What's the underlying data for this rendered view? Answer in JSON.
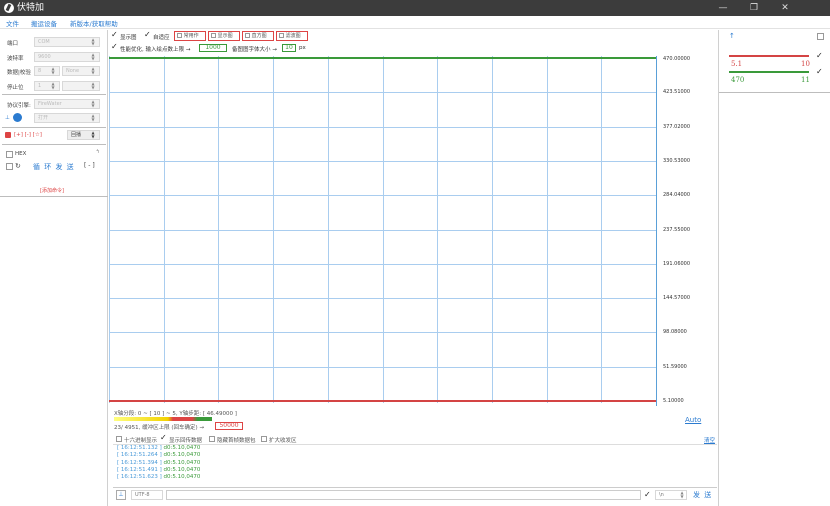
{
  "window": {
    "title": "伏特加",
    "minimize": "—",
    "maximize": "❐",
    "close": "✕"
  },
  "menu": [
    "文件",
    "搬运设备",
    "新版本/获取帮助"
  ],
  "left_panel": {
    "fields": [
      {
        "label": "端口",
        "value": "COM"
      },
      {
        "label": "波特率",
        "value": "9600"
      },
      {
        "label": "数据|校验",
        "value": "8",
        "value2": "None"
      },
      {
        "label": "停止位",
        "value": "1"
      }
    ],
    "protocol_label": "协议引擎:",
    "protocol_value": "FireWater",
    "connect_hint": "打开",
    "cmd_icons": "[+] [-] [☆]",
    "cmd_button": "回播",
    "hex_label": "HEX",
    "loop_send": "循 环 发 送",
    "loop_bracket": "[ - ]",
    "add_command": "[添加命令]"
  },
  "toolbar": {
    "show_graph": "显示图",
    "follow": "自适应",
    "tabs": [
      "常用作",
      "显示图",
      "直方图",
      "滤波图"
    ],
    "perf_label": "性能优化, 输入绘点数上限 →",
    "perf_value": "1000",
    "font_label": "备图图字体大小 →",
    "font_value": "10",
    "font_unit": "px"
  },
  "chart_data": {
    "type": "line",
    "y_ticks": [
      "470.00000",
      "423.51000",
      "377.02000",
      "330.53000",
      "284.04000",
      "237.55000",
      "191.06000",
      "144.57000",
      "98.08000",
      "51.59000",
      "5.10000"
    ],
    "ylim": [
      5.1,
      470.0
    ],
    "series": [
      {
        "values": [
          470,
          470
        ],
        "color": "#3a9a3a"
      },
      {
        "values": [
          5.1,
          5.1
        ],
        "color": "#d44444"
      }
    ],
    "grid": true,
    "auto_label": "Auto"
  },
  "status": {
    "x_range": "X轴分段: 0 ~ [ 10 ] ~ 5,  Y轴步距: [ 46.49000 ]",
    "buffer": "23/ 4951, 缓冲区上限 (回车确定) →",
    "buffer_value": "50000",
    "options": [
      "十六进制显示",
      "显示回传数据",
      "隐藏首帧数据包",
      "扩大收发区"
    ],
    "clear": "清空"
  },
  "log": [
    {
      "ts": "[ 16:12:51.132 ]",
      "val": "d0:5.10,0470"
    },
    {
      "ts": "[ 16:12:51.264 ]",
      "val": "d0:5.10,0470"
    },
    {
      "ts": "[ 16:12:51.394 ]",
      "val": "d0:5.10,0470"
    },
    {
      "ts": "[ 16:12:51.491 ]",
      "val": "d0:5.10,0470"
    },
    {
      "ts": "[ 16:12:51.623 ]",
      "val": "d0:5.10,0470"
    }
  ],
  "bottom": {
    "encoding": "UTF-8",
    "newline": "\\n",
    "send": "发 送"
  },
  "right_panel": {
    "ch1_label": "5.1",
    "ch1_value": "10",
    "ch1_color": "#d44444",
    "ch2_label": "470",
    "ch2_value": "11",
    "ch2_color": "#3a9a3a"
  }
}
